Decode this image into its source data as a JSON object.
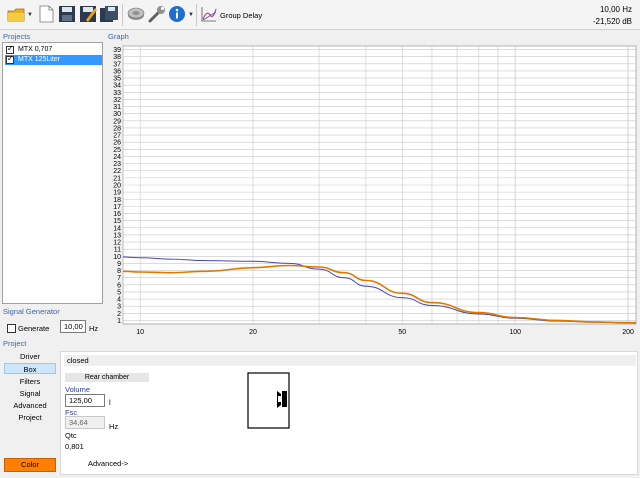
{
  "toolbar": {
    "group_delay_label": "Group Delay",
    "readout_frequency": "10,00 Hz",
    "readout_level": "-21,520 dB",
    "icons": [
      "open-folder-icon",
      "new-document-icon",
      "save-icon",
      "save-as-icon",
      "save-all-icon",
      "driver-icon",
      "settings-wrench-icon",
      "info-icon",
      "group-delay-chart-icon"
    ]
  },
  "projects": {
    "title": "Projects",
    "items": [
      {
        "label": "MTX 0,707",
        "checked": true,
        "selected": false
      },
      {
        "label": "MTX 125Liter",
        "checked": true,
        "selected": true
      }
    ]
  },
  "graph": {
    "title": "Graph"
  },
  "chart_data": {
    "type": "line",
    "x_scale": "log",
    "xlim": [
      9,
      210
    ],
    "ylim": [
      0.5,
      39.5
    ],
    "x_ticks": [
      10,
      20,
      50,
      100,
      200
    ],
    "y_ticks": [
      1,
      2,
      3,
      4,
      5,
      6,
      7,
      8,
      9,
      10,
      11,
      12,
      13,
      14,
      15,
      16,
      17,
      18,
      19,
      20,
      21,
      22,
      23,
      24,
      25,
      26,
      27,
      28,
      29,
      30,
      31,
      32,
      33,
      34,
      35,
      36,
      37,
      38,
      39
    ],
    "grid": true,
    "series": [
      {
        "color": "#4848b0",
        "x": [
          9,
          10,
          12,
          15,
          20,
          25,
          30,
          35,
          40,
          50,
          60,
          80,
          100,
          130,
          160,
          200,
          210
        ],
        "y": [
          9.9,
          9.8,
          9.6,
          9.4,
          9.3,
          9.0,
          8.2,
          7.0,
          5.8,
          4.2,
          3.1,
          1.9,
          1.3,
          0.9,
          0.75,
          0.65,
          0.62
        ]
      },
      {
        "color": "#e07800",
        "x": [
          9,
          10,
          12,
          15,
          20,
          25,
          30,
          35,
          40,
          50,
          60,
          80,
          100,
          130,
          160,
          200,
          210
        ],
        "y": [
          7.9,
          7.8,
          7.7,
          7.9,
          8.4,
          8.7,
          8.5,
          7.7,
          6.6,
          4.8,
          3.5,
          2.1,
          1.4,
          1.0,
          0.8,
          0.7,
          0.68
        ]
      }
    ]
  },
  "signal_generator": {
    "title": "Signal Generator",
    "generate_label": "Generate",
    "generate_checked": false,
    "frequency_value": "10,00",
    "frequency_unit": "Hz"
  },
  "project_nav": {
    "title": "Project",
    "items": [
      {
        "label": "Driver",
        "selected": false
      },
      {
        "label": "Box",
        "selected": true
      },
      {
        "label": "Filters",
        "selected": false
      },
      {
        "label": "Signal",
        "selected": false
      },
      {
        "label": "Advanced",
        "selected": false
      },
      {
        "label": "Project",
        "selected": false
      }
    ]
  },
  "box_panel": {
    "enclosure_type": "closed",
    "rear_chamber_label": "Rear chamber",
    "volume_label": "Volume",
    "volume_value": "125,00",
    "volume_unit": "l",
    "fsc_label": "Fsc",
    "fsc_value": "34,64",
    "fsc_unit": "Hz",
    "qtc_label": "Qtc",
    "qtc_value": "0,801",
    "advanced_link": "Advanced->"
  },
  "color_button": {
    "label": "Color",
    "color": "#ff8000"
  }
}
